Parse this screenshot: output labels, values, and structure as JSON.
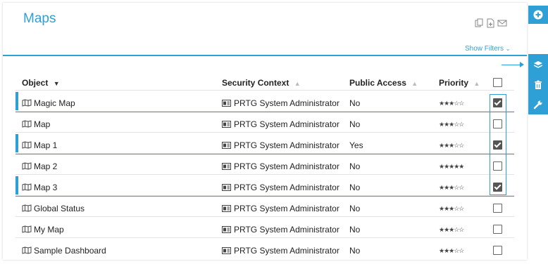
{
  "page": {
    "title": "Maps",
    "show_filters": "Show Filters"
  },
  "header_icons": [
    "clone-icon",
    "add-document-icon",
    "mail-icon"
  ],
  "columns": {
    "object": "Object",
    "security": "Security Context",
    "public": "Public Access",
    "priority": "Priority"
  },
  "rows": [
    {
      "name": "Magic Map",
      "security": "PRTG System Administrator",
      "public": "No",
      "priority": 3,
      "selected": true
    },
    {
      "name": "Map",
      "security": "PRTG System Administrator",
      "public": "No",
      "priority": 3,
      "selected": false
    },
    {
      "name": "Map 1",
      "security": "PRTG System Administrator",
      "public": "Yes",
      "priority": 3,
      "selected": true
    },
    {
      "name": "Map 2",
      "security": "PRTG System Administrator",
      "public": "No",
      "priority": 5,
      "selected": false
    },
    {
      "name": "Map 3",
      "security": "PRTG System Administrator",
      "public": "No",
      "priority": 3,
      "selected": true
    },
    {
      "name": "Global Status",
      "security": "PRTG System Administrator",
      "public": "No",
      "priority": 3,
      "selected": false
    },
    {
      "name": "My Map",
      "security": "PRTG System Administrator",
      "public": "No",
      "priority": 3,
      "selected": false
    },
    {
      "name": "Sample Dashboard",
      "security": "PRTG System Administrator",
      "public": "No",
      "priority": 3,
      "selected": false
    }
  ],
  "sidebar_actions": [
    "add-icon",
    "layers-icon",
    "trash-icon",
    "wrench-icon"
  ],
  "colors": {
    "accent": "#2fa0d6"
  }
}
